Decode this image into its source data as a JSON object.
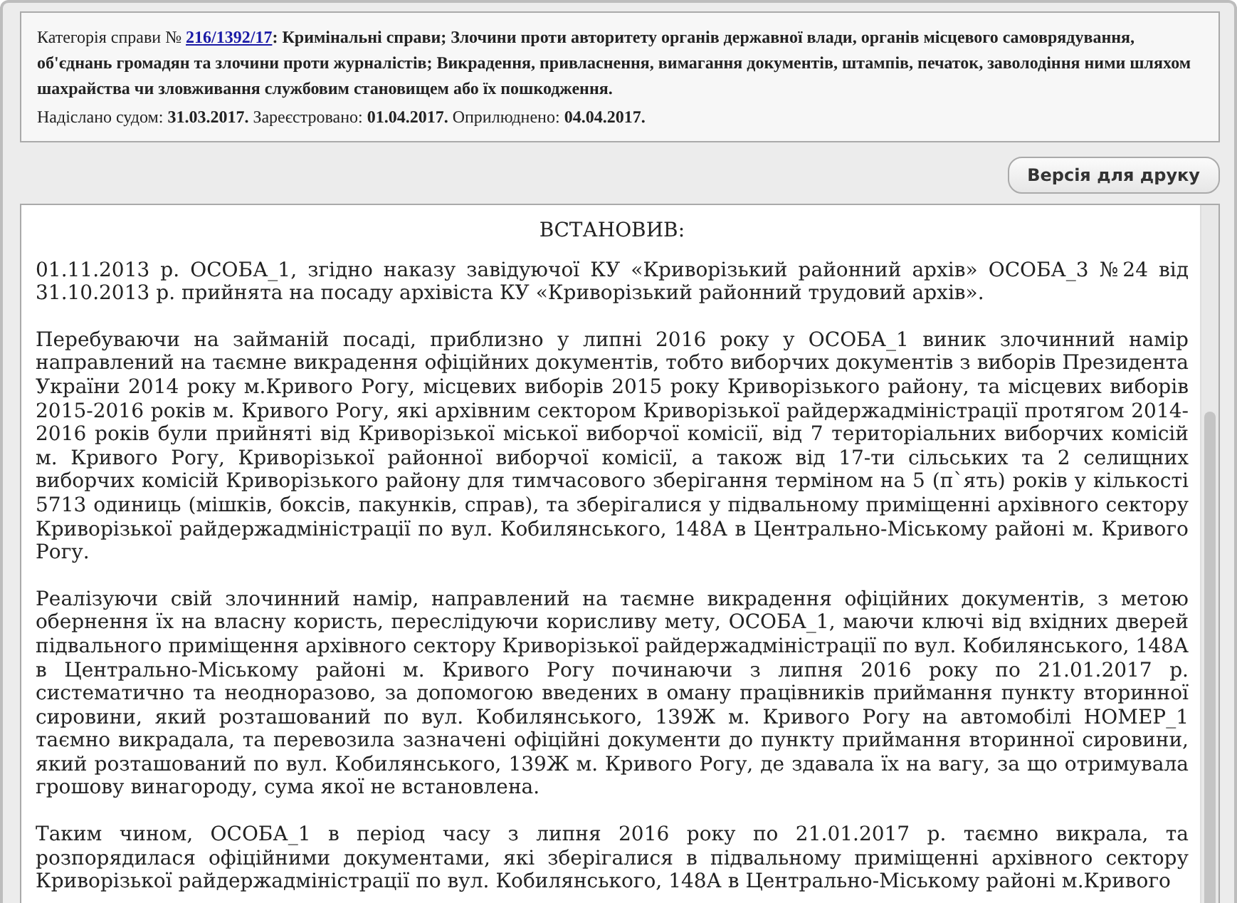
{
  "case_info": {
    "category_label": "Категорія справи №",
    "case_number": "216/1392/17",
    "category": ": Кримінальні справи; Злочини проти авторитету органів державної влади, органів місцевого самоврядування, об'єднань громадян та злочини проти журналістів; Викрадення, привласнення, вимагання документів, штампів, печаток, заволодіння ними шляхом шахрайства чи зловживання службовим становищем або їх пошкодження.",
    "dates": [
      {
        "label": "Надіслано судом:",
        "value": "31.03.2017."
      },
      {
        "label": "Зареєстровано:",
        "value": "01.04.2017."
      },
      {
        "label": "Оприлюднено:",
        "value": "04.04.2017."
      }
    ]
  },
  "print_button": "Версія для друку",
  "document": {
    "heading": "ВСТАНОВИВ:",
    "paragraphs": [
      "01.11.2013 р. ОСОБА_1, згідно наказу завідуючої КУ «Криворізький районний архів» ОСОБА_3 №24 від 31.10.2013 р. прийнята на посаду архівіста КУ «Криворізький районний трудовий архів».",
      "Перебуваючи на займаній посаді, приблизно у липні 2016 року у ОСОБА_1 виник злочинний намір направлений на таємне викрадення офіційних документів, тобто виборчих документів з виборів Президента України 2014 року м.Кривого Рогу, місцевих виборів 2015 року Криворізького району, та місцевих виборів 2015-2016 років м. Кривого Рогу, які архівним сектором Криворізької райдержадміністрації протягом 2014-2016 років були прийняті від Криворізької міської виборчої комісії, від 7 територіальних виборчих комісій м. Кривого Рогу, Криворізької районної виборчої комісії, а також від 17-ти сільських та 2 селищних виборчих комісій Криворізького району для тимчасового зберігання терміном на 5 (п`ять) років у кількості 5713 одиниць (мішків, боксів, пакунків, справ), та зберігалися у підвальному приміщенні архівного сектору Криворізької райдержадміністрації по вул. Кобилянського, 148А в Центрально-Міському районі м. Кривого Рогу.",
      "Реалізуючи свій злочинний намір, направлений на таємне викрадення офіційних документів, з метою обернення їх на власну користь, переслідуючи корисливу мету, ОСОБА_1, маючи ключі від вхідних дверей підвального приміщення архівного сектору Криворізької райдержадміністрації по вул. Кобилянського, 148А в Центрально-Міському районі м. Кривого Рогу починаючи з липня 2016 року по 21.01.2017 р. систематично та неодноразово, за допомогою введених в оману працівників приймання пункту вторинної сировини, який розташований по вул. Кобилянського, 139Ж м. Кривого Рогу на автомобілі НОМЕР_1 таємно викрадала, та перевозила зазначені офіційні документи до пункту приймання вторинної сировини, який розташований по вул. Кобилянського, 139Ж м. Кривого Рогу, де здавала їх на вагу, за що отримувала грошову винагороду, сума якої не встановлена.",
      "Таким чином, ОСОБА_1 в період часу з липня 2016 року по 21.01.2017 р. таємно викрала, та розпорядилася офіційними документами, які зберігалися в підвальному приміщенні архівного сектору Криворізької райдержадміністрації по вул. Кобилянського, 148А в Центрально-Міському районі м.Кривого"
    ]
  }
}
